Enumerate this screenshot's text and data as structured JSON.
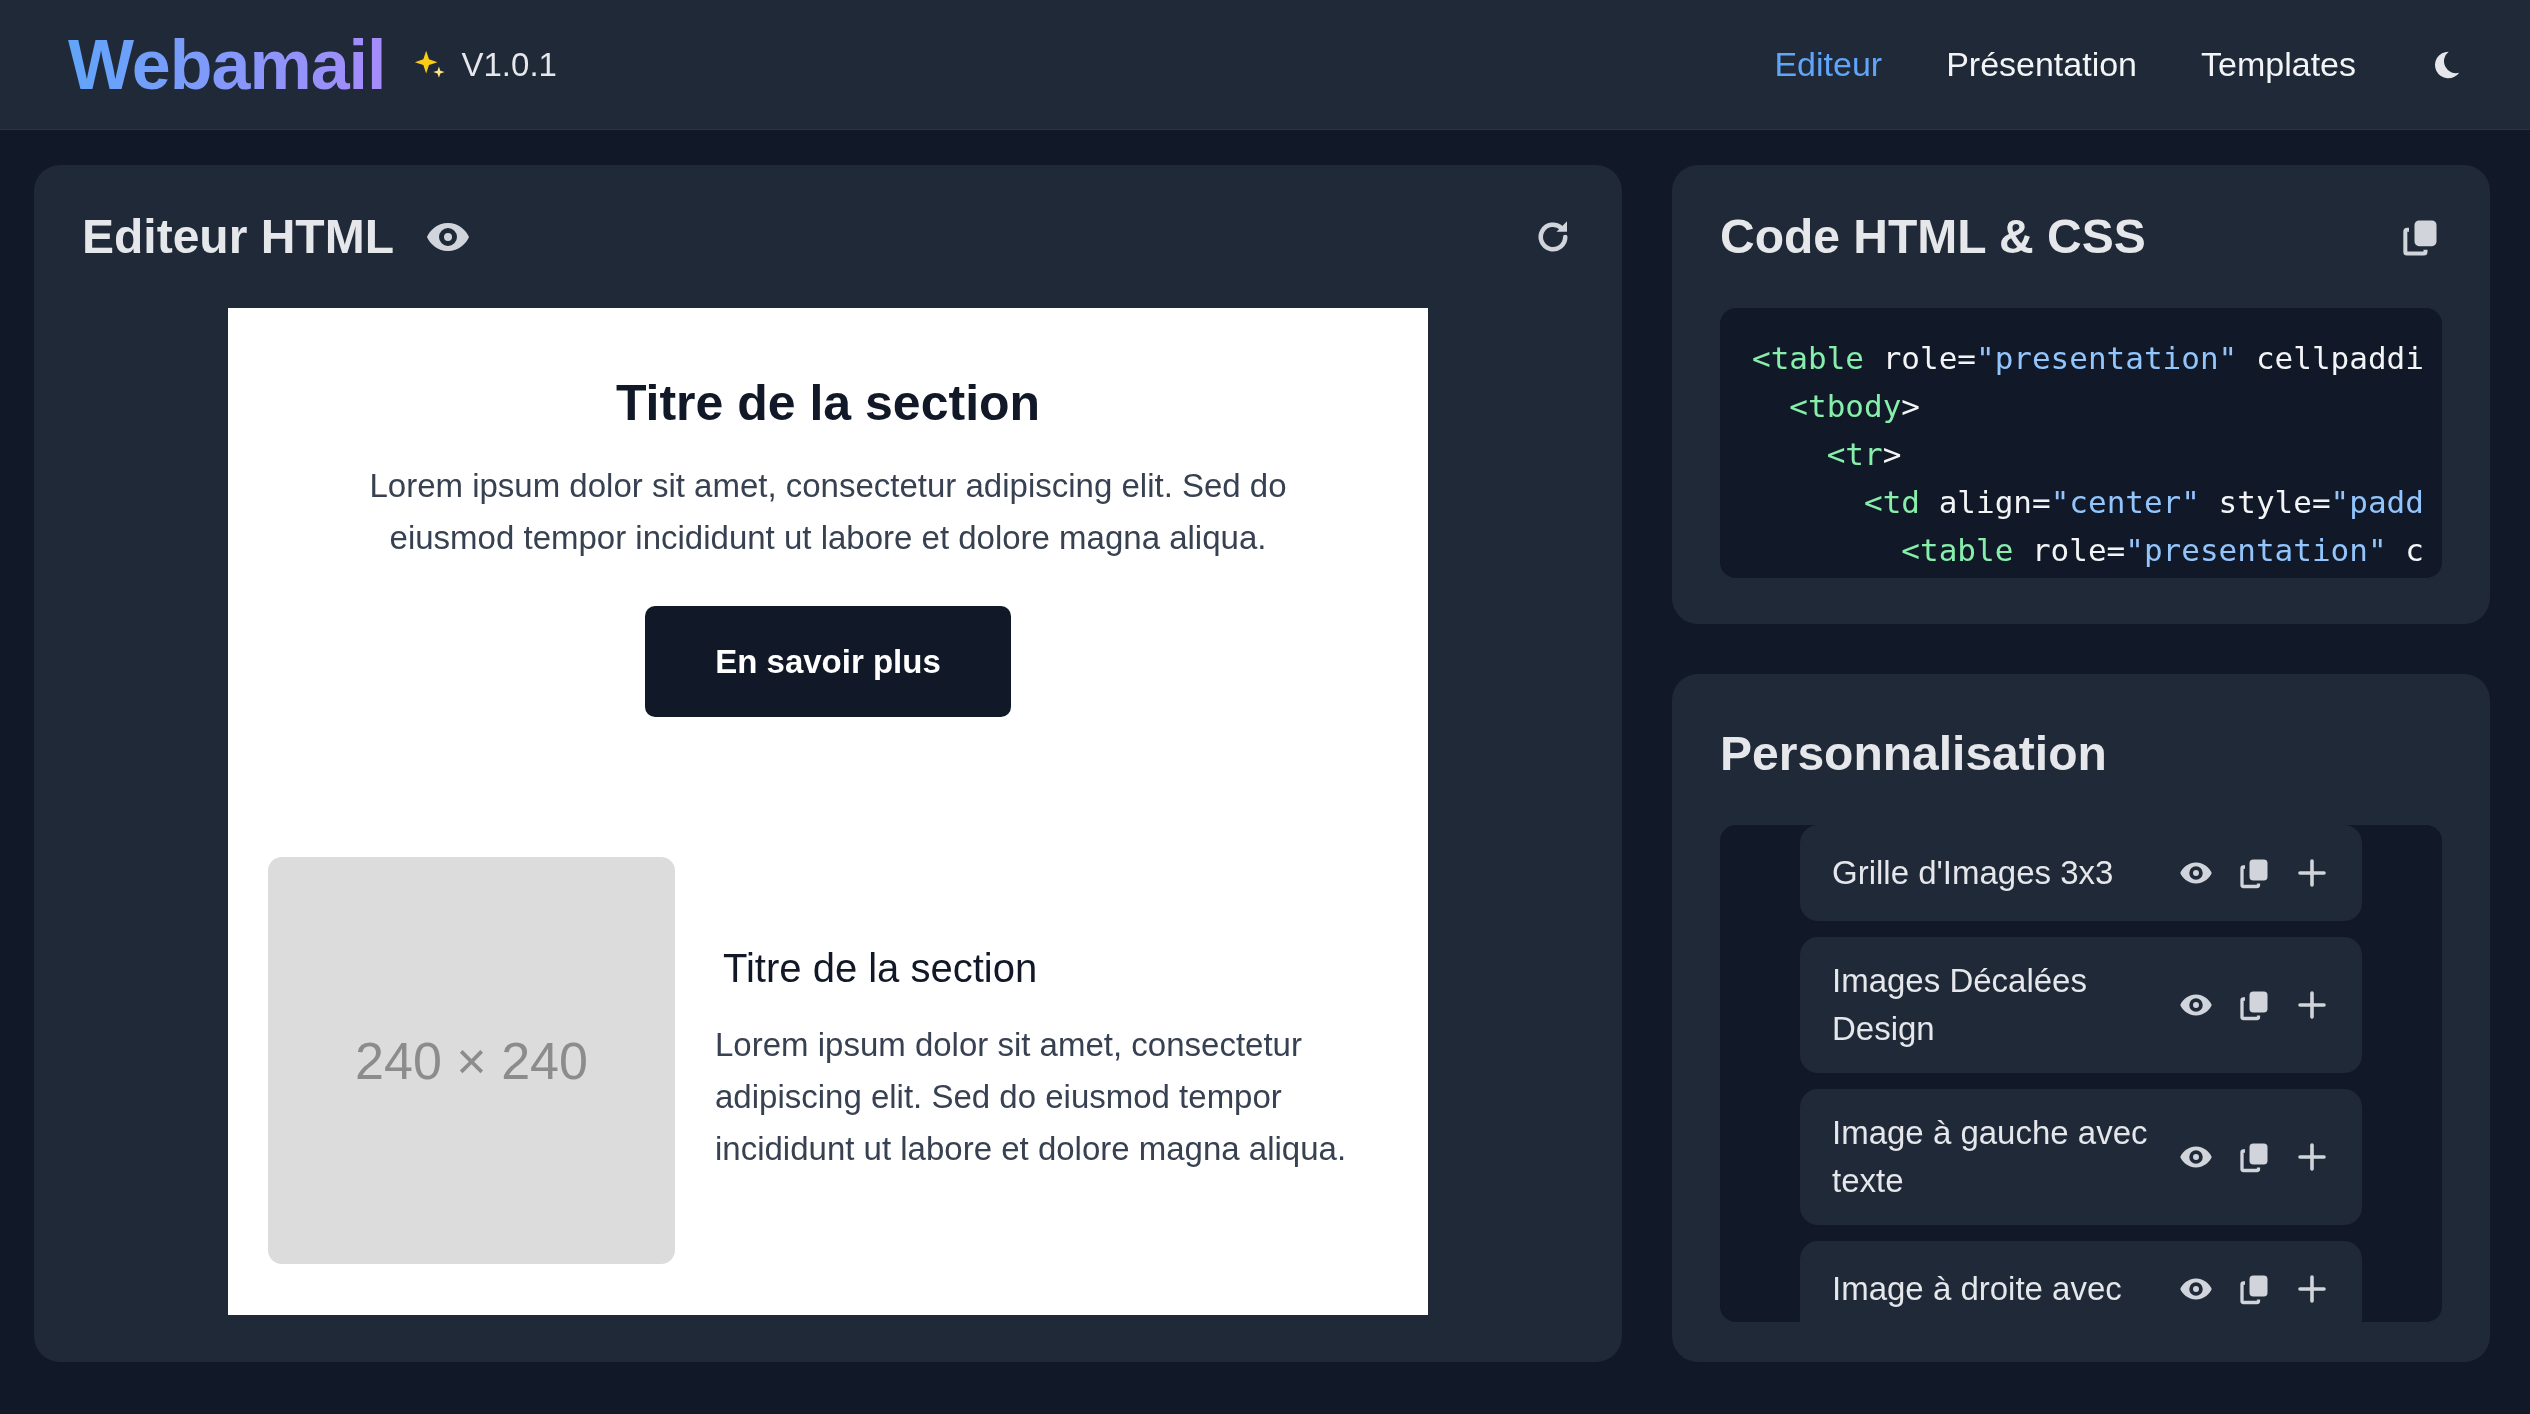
{
  "header": {
    "logo": "Webamail",
    "version": "V1.0.1",
    "nav": [
      {
        "label": "Editeur",
        "selected": true
      },
      {
        "label": "Présentation",
        "selected": false
      },
      {
        "label": "Templates",
        "selected": false
      }
    ]
  },
  "editor": {
    "title": "Editeur HTML",
    "preview": {
      "hero": {
        "title": "Titre de la section",
        "text": "Lorem ipsum dolor sit amet, consectetur adipiscing elit. Sed do eiusmod tempor incididunt ut labore et dolore magna aliqua.",
        "button": "En savoir plus"
      },
      "media": {
        "placeholder": "240 × 240",
        "title": "Titre de la section",
        "text": "Lorem ipsum dolor sit amet, consectetur adipiscing elit. Sed do eiusmod tempor incididunt ut labore et dolore magna aliqua."
      }
    }
  },
  "code": {
    "title": "Code HTML & CSS",
    "lines": [
      [
        {
          "kind": "tag",
          "text": "<table"
        },
        {
          "kind": "attr",
          "text": " role="
        },
        {
          "kind": "string",
          "text": "\"presentation\""
        },
        {
          "kind": "attr",
          "text": " cellpaddi"
        }
      ],
      [
        {
          "kind": "tag",
          "text": "  <tbody"
        },
        {
          "kind": "attr",
          "text": ">"
        }
      ],
      [
        {
          "kind": "tag",
          "text": "    <tr"
        },
        {
          "kind": "attr",
          "text": ">"
        }
      ],
      [
        {
          "kind": "tag",
          "text": "      <td"
        },
        {
          "kind": "attr",
          "text": " align="
        },
        {
          "kind": "string",
          "text": "\"center\""
        },
        {
          "kind": "attr",
          "text": " style="
        },
        {
          "kind": "string",
          "text": "\"padd"
        }
      ],
      [
        {
          "kind": "tag",
          "text": "        <table"
        },
        {
          "kind": "attr",
          "text": " role="
        },
        {
          "kind": "string",
          "text": "\"presentation\""
        },
        {
          "kind": "attr",
          "text": " c"
        }
      ]
    ]
  },
  "customization": {
    "title": "Personnalisation",
    "items": [
      {
        "label": "Grille d'Images 3x3"
      },
      {
        "label": "Images Décalées Design"
      },
      {
        "label": "Image à gauche avec texte"
      },
      {
        "label": "Image à droite avec"
      }
    ]
  }
}
